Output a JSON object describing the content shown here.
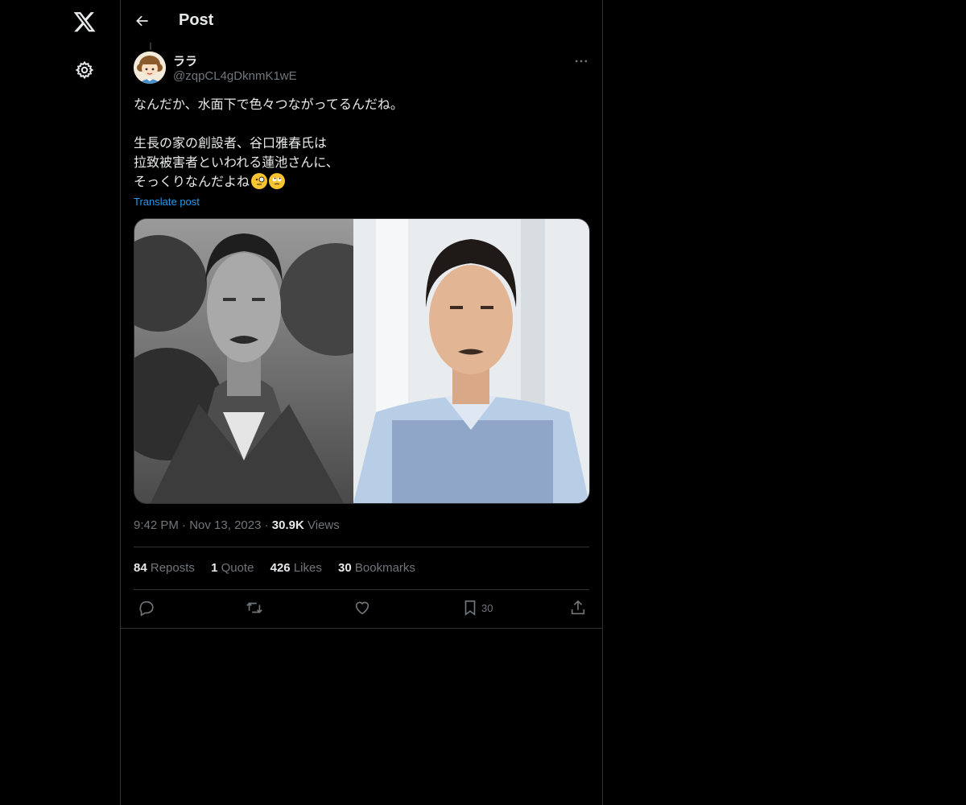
{
  "page": {
    "title": "Post"
  },
  "author": {
    "display_name": "ララ",
    "handle": "@zqpCL4gDknmK1wE"
  },
  "post": {
    "text": "なんだか、水面下で色々つながってるんだね。\n\n生長の家の創設者、谷口雅春氏は\n拉致被害者といわれる蓮池さんに、\nそっくりなんだよね",
    "translate_label": "Translate post",
    "time": "9:42 PM",
    "date": "Nov 13, 2023",
    "views_count": "30.9K",
    "views_label": "Views"
  },
  "stats": {
    "reposts_count": "84",
    "reposts_label": "Reposts",
    "quotes_count": "1",
    "quotes_label": "Quote",
    "likes_count": "426",
    "likes_label": "Likes",
    "bookmarks_count": "30",
    "bookmarks_label": "Bookmarks"
  },
  "actions": {
    "bookmark_count": "30"
  },
  "icons": [
    "x-logo-icon",
    "gear-icon",
    "back-arrow-icon",
    "more-icon",
    "reply-icon",
    "repost-icon",
    "like-icon",
    "bookmark-icon",
    "share-icon"
  ]
}
